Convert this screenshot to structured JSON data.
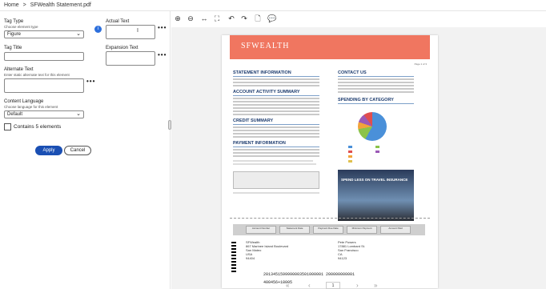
{
  "breadcrumb": {
    "home": "Home",
    "sep": ">",
    "file": "SFWealth Statement.pdf"
  },
  "panel": {
    "tag_type": {
      "label": "Tag Type",
      "sub": "Choose element type",
      "value": "Figure"
    },
    "tag_title": {
      "label": "Tag Title",
      "value": ""
    },
    "alt_text": {
      "label": "Alternate Text",
      "sub": "Enter static alternate text for this element"
    },
    "content_language": {
      "label": "Content Language",
      "sub": "Choose language for this element",
      "value": "Default"
    },
    "contains": "Contains 5 elements",
    "apply": "Apply",
    "cancel": "Cancel",
    "actual_text": {
      "label": "Actual Text",
      "cursor": "I"
    },
    "expansion_text": {
      "label": "Expansion Text"
    },
    "more": "•••",
    "info_icon": "i"
  },
  "toolbar": {
    "icons": [
      "zoom-in-icon",
      "zoom-out-icon",
      "fit-width-icon",
      "fit-page-icon",
      "rotate-left-icon",
      "rotate-right-icon",
      "document-icon",
      "comment-icon"
    ],
    "glyphs": [
      "⊕",
      "⊖",
      "↔",
      "⛶",
      "↶",
      "↷",
      "🗋",
      "💬"
    ]
  },
  "doc": {
    "brand": "SFWEALTH",
    "page_no": "Page 1 of 3",
    "statement_info": "STATEMENT INFORMATION",
    "account_summary": "ACCOUNT ACTIVITY SUMMARY",
    "credit_summary": "CREDIT SUMMARY",
    "payment_info": "PAYMENT INFORMATION",
    "contact_us": "CONTACT US",
    "spending": "SPENDING BY CATEGORY",
    "ad_text": "SPEND LESS ON TRAVEL INSURANCE",
    "barcode_line": "2013451599990003501000001 200000000001",
    "barcode_line2": "400456+18005",
    "sender": {
      "name": "SFWealth",
      "line1": "867 Marinee Island Boulevard",
      "line2": "San Mateo",
      "line3": "USA",
      "line4": "94404"
    },
    "recipient": {
      "name": "Pete Powers",
      "line1": "17881 Lombard St.",
      "line2": "San Francisco",
      "line3": "CA",
      "line4": "94123"
    },
    "remit_cells": [
      "Account Number",
      "Statement Date",
      "Payment Due Date",
      "Minimum Payment",
      "Amount Paid"
    ]
  },
  "pager": {
    "first": "«",
    "prev": "‹",
    "page": "1",
    "next": "›",
    "last": "»"
  }
}
